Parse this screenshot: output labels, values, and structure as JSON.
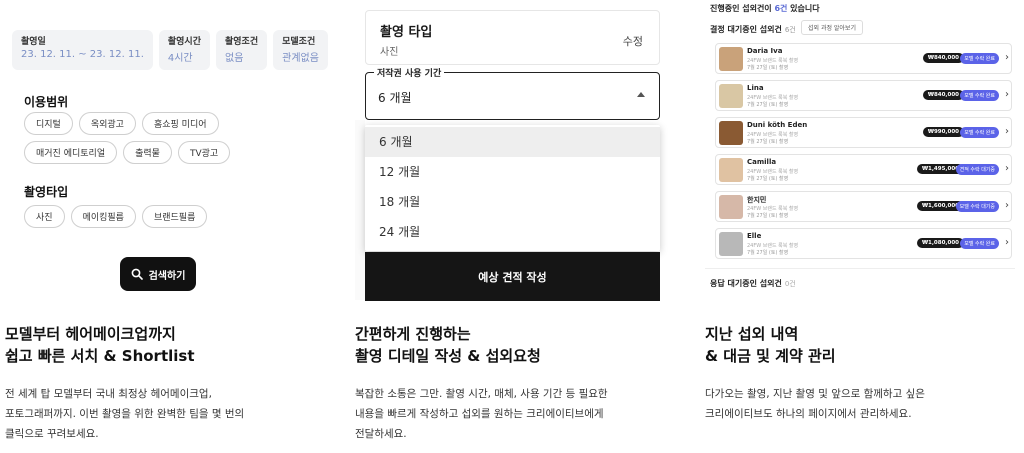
{
  "col1": {
    "meta": [
      {
        "label": "촬영일",
        "value": "23. 12. 11. ~ 23. 12. 11."
      },
      {
        "label": "촬영시간",
        "value": "4시간"
      },
      {
        "label": "촬영조건",
        "value": "없음"
      },
      {
        "label": "모델조건",
        "value": "관계없음"
      }
    ],
    "usage_title": "이용범위",
    "usage_chips": [
      "디지털",
      "옥외광고",
      "홈쇼핑 미디어",
      "매거진 에디토리얼",
      "출력물",
      "TV광고"
    ],
    "type_title": "촬영타입",
    "type_chips": [
      "사진",
      "메이킹필름",
      "브랜드필름"
    ],
    "search_label": "검색하기",
    "caption_title": [
      "모델부터 헤어메이크업까지",
      "쉽고 빠른 서치 & Shortlist"
    ],
    "caption_desc": [
      "전 세계 탑 모델부터 국내 최정상 헤어메이크업,",
      "포토그래퍼까지. 이번 촬영을 위한 완벽한 팀을 몇 번의",
      "클릭으로 꾸려보세요."
    ]
  },
  "col2": {
    "type_card": {
      "title": "촬영 타입",
      "sub": "사진",
      "edit": "수정"
    },
    "field": {
      "legend": "저작권 사용 기간",
      "value": "6 개월"
    },
    "options": [
      "6 개월",
      "12 개월",
      "18 개월",
      "24 개월"
    ],
    "selected_index": 0,
    "submit_label": "예상 견적 작성",
    "caption_title": [
      "간편하게 진행하는",
      "촬영 디테일 작성 & 섭외요청"
    ],
    "caption_desc": [
      "복잡한 소통은 그만. 촬영 시간, 매체, 사용 기간 등 필요한",
      "내용을 빠르게 작성하고 섭외를 원하는 크리에이티브에게",
      "전달하세요."
    ]
  },
  "col3": {
    "head_pre": "진행중인 섭외건이 ",
    "head_count": "6건",
    "head_post": " 있습니다",
    "sub_title": "결정 대기중인 섭외건",
    "sub_count": "6건",
    "filter_label": "섭외 과정 알아보기",
    "cards": [
      {
        "name": "Daria Iva",
        "desc": "24FW 브랜드 룩북 촬영",
        "date": "7월 27일 (토) 촬영",
        "price": "₩840,000",
        "status": "모델 수락 완료",
        "color": "#c9a27a"
      },
      {
        "name": "Lina",
        "desc": "24FW 브랜드 룩북 촬영",
        "date": "7월 27일 (토) 촬영",
        "price": "₩840,000",
        "status": "모델 수락 완료",
        "color": "#d9c7a4"
      },
      {
        "name": "Duni köth Eden",
        "desc": "24FW 브랜드 룩북 촬영",
        "date": "7월 27일 (토) 촬영",
        "price": "₩990,000",
        "status": "모델 수락 완료",
        "color": "#8a5a33"
      },
      {
        "name": "Camilla",
        "desc": "24FW 브랜드 룩북 촬영",
        "date": "7월 27일 (토) 촬영",
        "price": "₩1,495,000",
        "status": "견적 수락 대기중",
        "color": "#e0c2a2"
      },
      {
        "name": "한지민",
        "desc": "24FW 브랜드 룩북 촬영",
        "date": "7월 27일 (토) 촬영",
        "price": "₩1,600,000",
        "status": "모델 수락 대기중",
        "color": "#d6b8a8"
      },
      {
        "name": "Elle",
        "desc": "24FW 브랜드 룩북 촬영",
        "date": "7월 27일 (토) 촬영",
        "price": "₩1,080,000",
        "status": "모델 수락 완료",
        "color": "#b8b8b8"
      }
    ],
    "wait_title": "응답 대기중인 섭외건",
    "wait_count": "0건",
    "caption_title": [
      "지난 섭외 내역",
      "& 대금 및 계약 관리"
    ],
    "caption_desc": [
      "다가오는 촬영, 지난 촬영 및 앞으로 함께하고 싶은",
      "크리에이티브도 하나의 페이지에서 관리하세요."
    ]
  }
}
